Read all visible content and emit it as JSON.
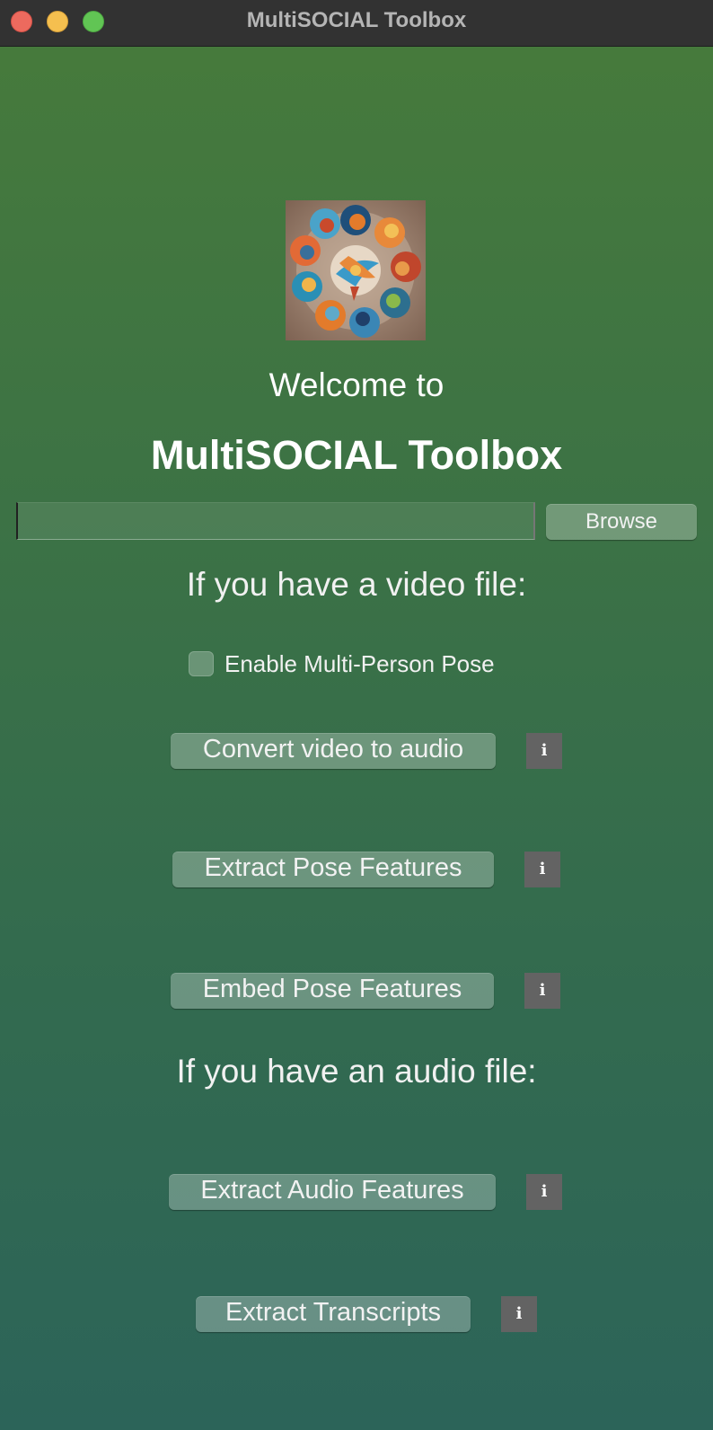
{
  "window": {
    "title": "MultiSOCIAL Toolbox"
  },
  "header": {
    "welcome": "Welcome to",
    "app_name": "MultiSOCIAL Toolbox",
    "logo_icon": "hands-circle-logo"
  },
  "file_picker": {
    "path_value": "",
    "browse_label": "Browse"
  },
  "video_section": {
    "heading": "If you have a video file:",
    "multi_person_checkbox": {
      "label": "Enable Multi-Person Pose",
      "checked": false
    },
    "buttons": [
      {
        "label": "Convert video to audio",
        "info": "i"
      },
      {
        "label": "Extract Pose Features",
        "info": "i"
      },
      {
        "label": "Embed Pose Features",
        "info": "i"
      }
    ]
  },
  "audio_section": {
    "heading": "If you have an audio file:",
    "buttons": [
      {
        "label": "Extract Audio Features",
        "info": "i"
      },
      {
        "label": "Extract Transcripts",
        "info": "i"
      }
    ]
  },
  "colors": {
    "background_top": "#467a3c",
    "background_bottom": "#2c6459",
    "info_button": "#636363",
    "titlebar": "#323232"
  }
}
